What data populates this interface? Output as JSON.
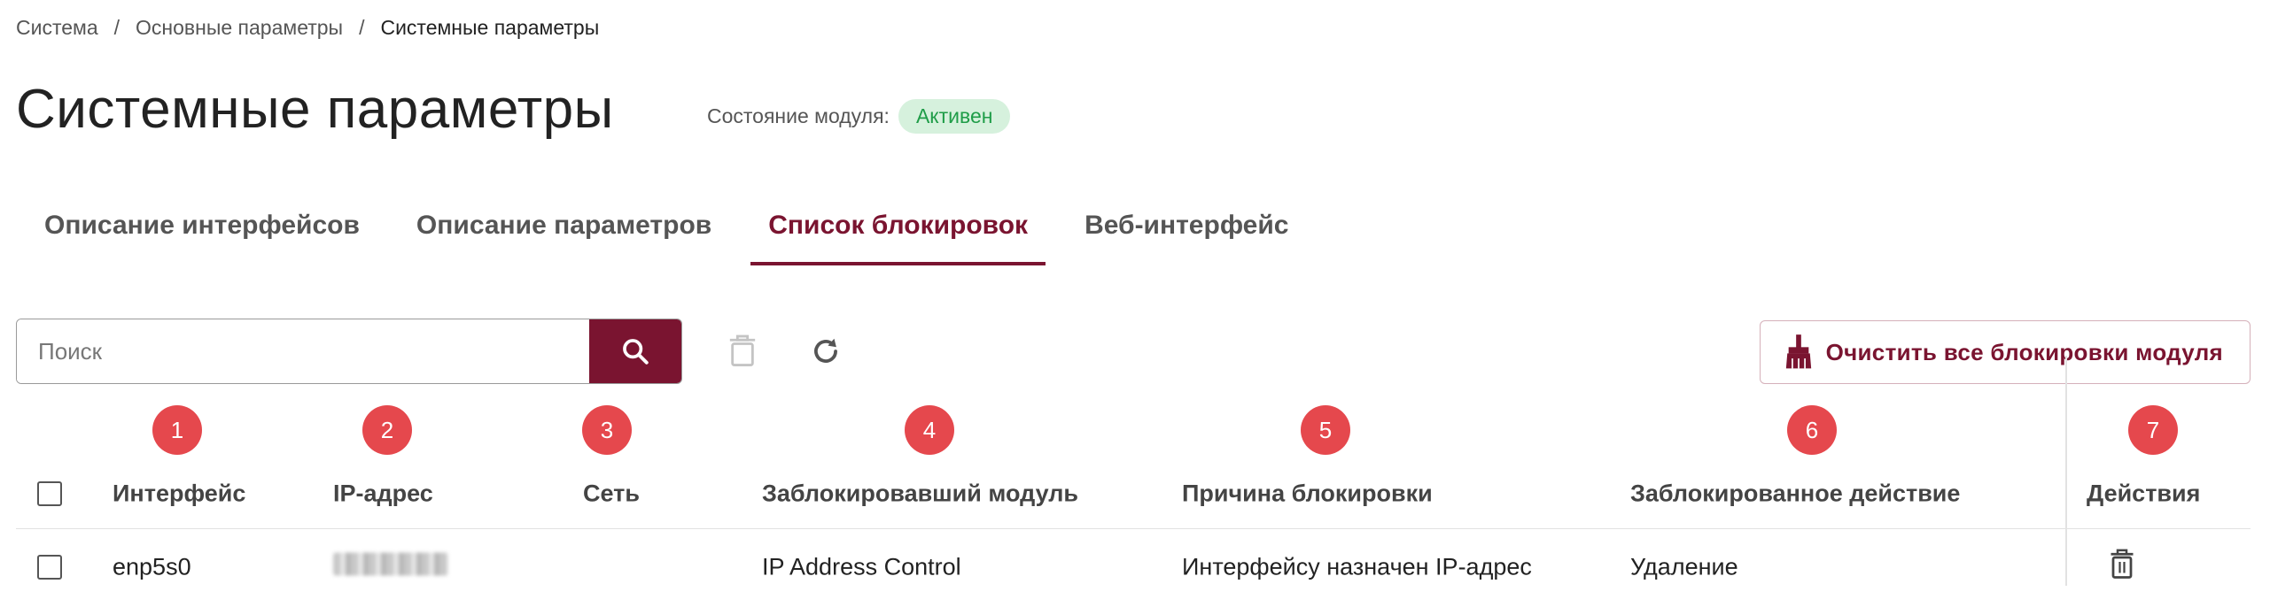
{
  "breadcrumb": {
    "items": [
      "Система",
      "Основные параметры",
      "Системные параметры"
    ],
    "separator": "/"
  },
  "page": {
    "title": "Системные параметры",
    "module_state_label": "Состояние модуля:",
    "module_state": "Активен"
  },
  "tabs": [
    {
      "label": "Описание интерфейсов",
      "active": false
    },
    {
      "label": "Описание параметров",
      "active": false
    },
    {
      "label": "Список блокировок",
      "active": true
    },
    {
      "label": "Веб-интерфейс",
      "active": false
    }
  ],
  "toolbar": {
    "search_placeholder": "Поиск",
    "clear_all_label": "Очистить все блокировки модуля"
  },
  "table": {
    "annotations": [
      "1",
      "2",
      "3",
      "4",
      "5",
      "6",
      "7"
    ],
    "columns": [
      "Интерфейс",
      "IP-адрес",
      "Сеть",
      "Заблокировавший модуль",
      "Причина блокировки",
      "Заблокированное действие",
      "Действия"
    ],
    "rows": [
      {
        "interface": "enp5s0",
        "ip": "",
        "network": "",
        "module": "IP Address Control",
        "reason": "Интерфейсу назначен IP-адрес",
        "action": "Удаление"
      }
    ]
  },
  "colors": {
    "accent": "#7a1430",
    "badge_bg": "#d6f1dd",
    "badge_text": "#1f9d48",
    "annotation": "#e5484d"
  },
  "icons": [
    "search-icon",
    "trash-icon",
    "refresh-icon",
    "broom-icon",
    "delete-row-icon"
  ]
}
